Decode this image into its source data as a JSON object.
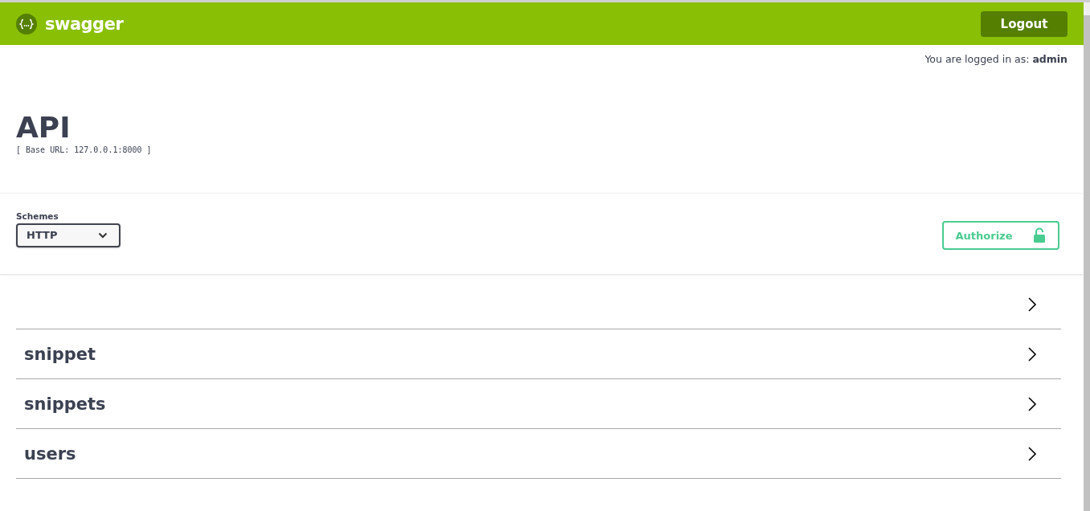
{
  "topbar": {
    "logo_text": "swagger",
    "logout_button": "Logout"
  },
  "login_status": {
    "text": "You are logged in as: **admin**"
  },
  "info": {
    "title": "API",
    "base_url": "[ Base URL: 127.0.0.1:8000 ]"
  },
  "schemes": {
    "label": "Schemes",
    "value": "HTTP"
  },
  "authorize_button": {
    "label": "Authorize",
    "locked": false
  },
  "tags": [
    {
      "expanded": false
    },
    {
      "name": "snippet",
      "expanded": false
    },
    {
      "name": "snippets",
      "expanded": false
    },
    {
      "name": "users",
      "expanded": false
    }
  ]
}
